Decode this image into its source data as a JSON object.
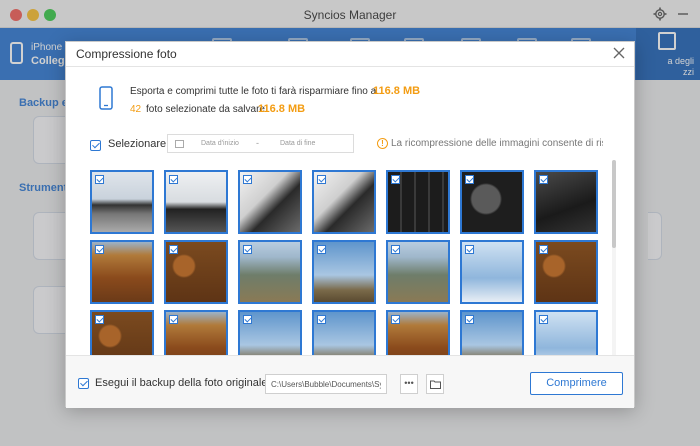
{
  "window": {
    "title": "Syncios Manager"
  },
  "toolbar": {
    "device_name": "iPhone",
    "device_status": "Collegat",
    "active_item_label": "a degli\nzzi"
  },
  "background": {
    "section_backup": "Backup e r",
    "section_tools": "Strumento"
  },
  "dialog": {
    "title": "Compressione foto",
    "info_text": "Esporta e comprimi tutte le foto ti farà risparmiare fino a",
    "info_size": "116.8 MB",
    "selected_count": "42",
    "selected_text": "foto selezionate da salvare",
    "selected_size": "116.8 MB",
    "select_label": "Selezionare",
    "date_start_placeholder": "Data d'inizio",
    "date_separator": "-",
    "date_end_placeholder": "Data di fine",
    "warning_text": "La ricompressione delle immagini consente di rispa...",
    "backup_label": "Esegui il backup della foto originale",
    "backup_path": "C:\\Users\\Bubble\\Documents\\Sync",
    "dots_label": "•••",
    "compress_button": "Comprimere"
  },
  "colors": {
    "accent": "#2e78d3",
    "highlight": "#f39c12"
  },
  "photos": [
    {
      "kind": "keyboard-screen",
      "checked": true
    },
    {
      "kind": "laptop-screen",
      "checked": true
    },
    {
      "kind": "laptop-cable",
      "checked": true
    },
    {
      "kind": "laptop-cable",
      "checked": true
    },
    {
      "kind": "keyboard-dark",
      "checked": true
    },
    {
      "kind": "keyboard-windows-key",
      "checked": true
    },
    {
      "kind": "keyboard-closeup",
      "checked": true
    },
    {
      "kind": "autumn-aerial",
      "checked": true
    },
    {
      "kind": "autumn-forest",
      "checked": true
    },
    {
      "kind": "river-aerial",
      "checked": true
    },
    {
      "kind": "plain-sky",
      "checked": true
    },
    {
      "kind": "river-aerial",
      "checked": true
    },
    {
      "kind": "bright-sky",
      "checked": true
    },
    {
      "kind": "autumn-forest",
      "checked": true
    },
    {
      "kind": "autumn-forest",
      "checked": true
    },
    {
      "kind": "autumn-aerial",
      "checked": true
    },
    {
      "kind": "plain-sky",
      "checked": true
    },
    {
      "kind": "plain-sky",
      "checked": true
    },
    {
      "kind": "autumn-aerial",
      "checked": true
    },
    {
      "kind": "plain-sky",
      "checked": true
    },
    {
      "kind": "bright-sky",
      "checked": true
    }
  ]
}
